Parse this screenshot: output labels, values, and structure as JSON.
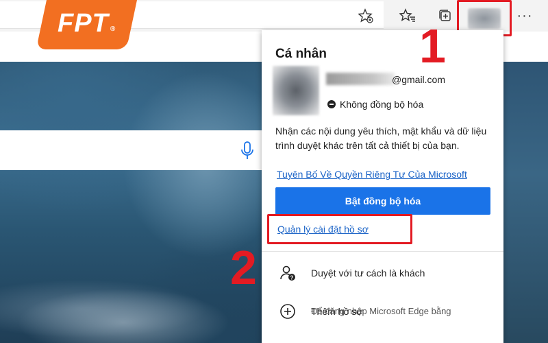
{
  "logo": {
    "text": "FPT",
    "registered": "®"
  },
  "toolbar": {
    "icons": [
      "favorite-add-icon",
      "favorites-icon",
      "collections-icon",
      "avatar",
      "more-icon"
    ],
    "more_label": "···"
  },
  "annotations": {
    "step1": "1",
    "step2": "2"
  },
  "profile_panel": {
    "title": "Cá nhân",
    "email_suffix": "@gmail.com",
    "sync_status": "Không đồng bộ hóa",
    "description": "Nhận các nội dung yêu thích, mật khẩu và dữ liệu trình duyệt khác trên tất cả thiết bị của bạn.",
    "privacy_link": "Tuyên Bố Về Quyền Riêng Tư Của Microsoft",
    "sync_button": "Bật đồng bộ hóa",
    "manage_link": "Quản lý cài đặt hồ sơ",
    "menu": [
      {
        "label": "Duyệt với tư cách là khách",
        "icon": "guest-icon"
      },
      {
        "label": "Thêm hồ sơ",
        "icon": "add-profile-icon",
        "sub": "Để đăng nhập Microsoft Edge bằng"
      }
    ]
  },
  "colors": {
    "accent": "#1a73e8",
    "highlight": "#e31b23",
    "logo": "#f26f21",
    "link": "#1a63c7"
  }
}
